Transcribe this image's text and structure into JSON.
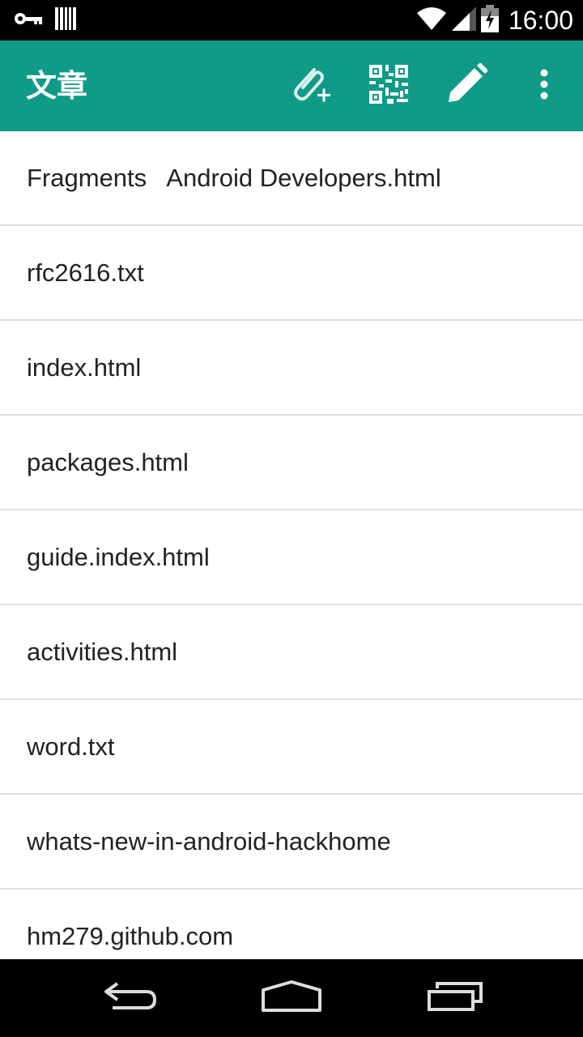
{
  "status_bar": {
    "time": "16:00",
    "icons": [
      "key-icon",
      "barcode-icon",
      "wifi-icon",
      "signal-icon",
      "battery-icon"
    ]
  },
  "app_bar": {
    "title": "文章",
    "background": "#109a88",
    "actions": [
      "attach-add-icon",
      "qr-code-icon",
      "pencil-icon",
      "overflow-menu-icon"
    ]
  },
  "file_list": {
    "items": [
      {
        "label": "Fragments   Android Developers.html"
      },
      {
        "label": "rfc2616.txt"
      },
      {
        "label": "index.html"
      },
      {
        "label": "packages.html"
      },
      {
        "label": "guide.index.html"
      },
      {
        "label": "activities.html"
      },
      {
        "label": "word.txt"
      },
      {
        "label": "whats-new-in-android-hackhome"
      },
      {
        "label": "hm279.github.com"
      }
    ]
  },
  "nav_bar": {
    "buttons": [
      "back-icon",
      "home-icon",
      "recents-icon"
    ]
  }
}
